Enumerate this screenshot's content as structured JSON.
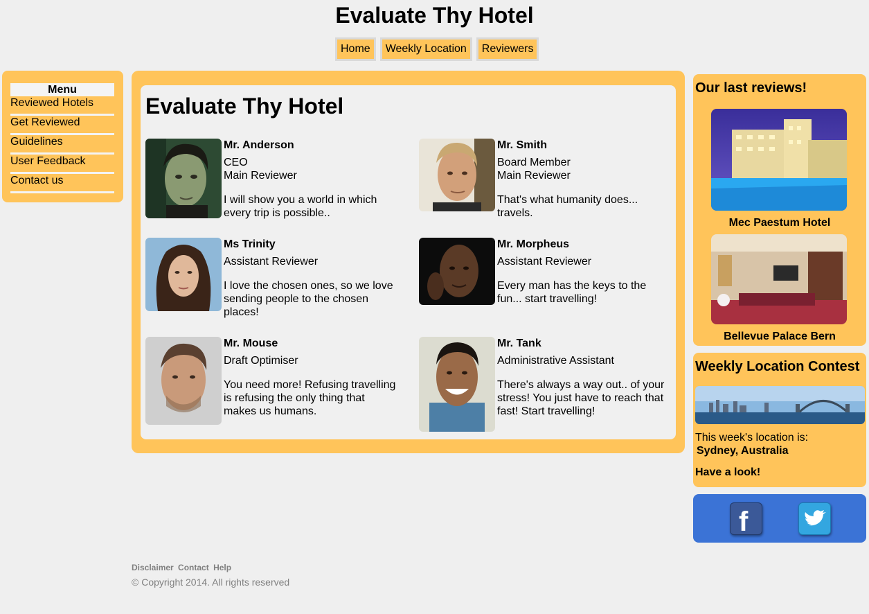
{
  "site": {
    "title": "Evaluate Thy Hotel"
  },
  "topnav": [
    "Home",
    "Weekly Location",
    "Reviewers"
  ],
  "menu": {
    "title": "Menu",
    "items": [
      "Reviewed Hotels",
      "Get Reviewed",
      "Guidelines",
      "User Feedback",
      "Contact us"
    ]
  },
  "main": {
    "heading": "Evaluate Thy Hotel",
    "reviewers": [
      {
        "name": "Mr. Anderson",
        "roles": [
          "CEO",
          "Main Reviewer"
        ],
        "quote": "I will show you a world in which every trip is possible.."
      },
      {
        "name": "Mr. Smith",
        "roles": [
          "Board Member",
          "Main Reviewer"
        ],
        "quote": "That's what humanity does... travels."
      },
      {
        "name": "Ms Trinity",
        "roles": [
          "Assistant Reviewer"
        ],
        "quote": "I love the chosen ones, so we love sending people to the chosen places!"
      },
      {
        "name": "Mr. Morpheus",
        "roles": [
          "Assistant Reviewer"
        ],
        "quote": "Every man has the keys to the fun... start travelling!"
      },
      {
        "name": "Mr. Mouse",
        "roles": [
          "Draft Optimiser"
        ],
        "quote": "You need more! Refusing travelling is refusing the only thing that makes us humans."
      },
      {
        "name": "Mr. Tank",
        "roles": [
          "Administrative Assistant"
        ],
        "quote": "There's always a way out.. of your stress! You just have to reach that fast! Start travelling!"
      }
    ]
  },
  "sidebar": {
    "reviews": {
      "title": "Our last reviews!",
      "hotels": [
        "Mec Paestum Hotel",
        "Bellevue Palace Bern"
      ]
    },
    "contest": {
      "title": "Weekly Location Contest",
      "intro": "This week's location is:",
      "location": "Sydney, Australia",
      "cta": "Have a look!"
    },
    "social": [
      "facebook-icon",
      "twitter-icon"
    ]
  },
  "footer": {
    "links": [
      "Disclaimer",
      "Contact",
      "Help"
    ],
    "copyright": "© Copyright 2014. All rights reserved"
  },
  "colors": {
    "accent": "#ffc45a",
    "background": "#efefef",
    "social": "#3b73d6"
  }
}
